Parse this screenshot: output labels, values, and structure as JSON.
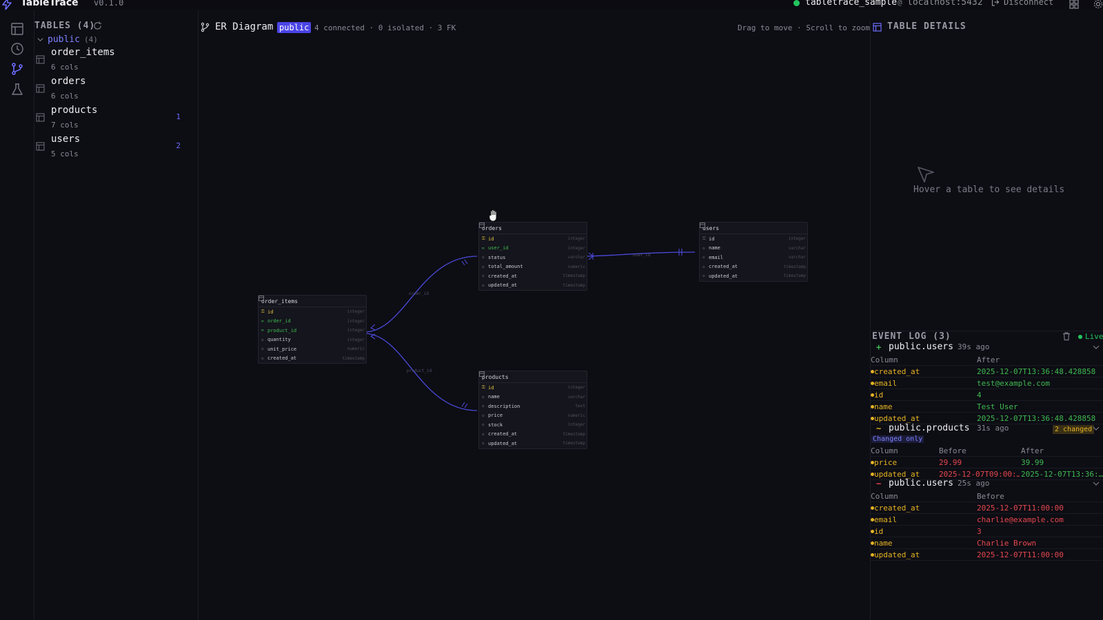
{
  "app": {
    "title": "TableTrace",
    "version": "v0.1.0"
  },
  "connection": {
    "database": "tabletrace_sample",
    "at": "@",
    "host": "localhost:5432",
    "disconnect_label": "Disconnect"
  },
  "sidebar": {
    "header": "TABLES (4)",
    "schema": {
      "name": "public",
      "count": "(4)"
    },
    "tables": [
      {
        "name": "order_items",
        "cols": "6 cols",
        "badge": ""
      },
      {
        "name": "orders",
        "cols": "6 cols",
        "badge": ""
      },
      {
        "name": "products",
        "cols": "7 cols",
        "badge": "1"
      },
      {
        "name": "users",
        "cols": "5 cols",
        "badge": "2"
      }
    ]
  },
  "er": {
    "title": "ER Diagram",
    "schema_badge": "public",
    "stats": "4 connected · 0 isolated · 3 FK",
    "hint": "Drag to move · Scroll to zoom",
    "edge_labels": [
      "user_id",
      "order_id",
      "product_id"
    ],
    "nodes": {
      "orders": {
        "title": "orders",
        "columns": [
          {
            "key": "⚿",
            "name": "id",
            "type": "integer",
            "kind": "pk"
          },
          {
            "key": "∞",
            "name": "user_id",
            "type": "integer",
            "kind": "fk"
          },
          {
            "key": "◇",
            "name": "status",
            "type": "varchar",
            "kind": ""
          },
          {
            "key": "◇",
            "name": "total_amount",
            "type": "numeric",
            "kind": ""
          },
          {
            "key": "◇",
            "name": "created_at",
            "type": "timestamp",
            "kind": ""
          },
          {
            "key": "◇",
            "name": "updated_at",
            "type": "timestamp",
            "kind": ""
          }
        ]
      },
      "users": {
        "title": "users",
        "columns": [
          {
            "key": "⚿",
            "name": "id",
            "type": "integer",
            "kind": ""
          },
          {
            "key": "◇",
            "name": "name",
            "type": "varchar",
            "kind": ""
          },
          {
            "key": "◇",
            "name": "email",
            "type": "varchar",
            "kind": ""
          },
          {
            "key": "◇",
            "name": "created_at",
            "type": "timestamp",
            "kind": ""
          },
          {
            "key": "◇",
            "name": "updated_at",
            "type": "timestamp",
            "kind": ""
          }
        ]
      },
      "order_items": {
        "title": "order_items",
        "columns": [
          {
            "key": "⚿",
            "name": "id",
            "type": "integer",
            "kind": "pk"
          },
          {
            "key": "∞",
            "name": "order_id",
            "type": "integer",
            "kind": "fk"
          },
          {
            "key": "∞",
            "name": "product_id",
            "type": "integer",
            "kind": "fk"
          },
          {
            "key": "◇",
            "name": "quantity",
            "type": "integer",
            "kind": ""
          },
          {
            "key": "◇",
            "name": "unit_price",
            "type": "numeric",
            "kind": ""
          },
          {
            "key": "◇",
            "name": "created_at",
            "type": "timestamp",
            "kind": ""
          }
        ]
      },
      "products": {
        "title": "products",
        "columns": [
          {
            "key": "⚿",
            "name": "id",
            "type": "integer",
            "kind": "pk"
          },
          {
            "key": "◇",
            "name": "name",
            "type": "varchar",
            "kind": ""
          },
          {
            "key": "◇",
            "name": "description",
            "type": "text",
            "kind": ""
          },
          {
            "key": "◇",
            "name": "price",
            "type": "numeric",
            "kind": ""
          },
          {
            "key": "◇",
            "name": "stock",
            "type": "integer",
            "kind": ""
          },
          {
            "key": "◇",
            "name": "created_at",
            "type": "timestamp",
            "kind": ""
          },
          {
            "key": "◇",
            "name": "updated_at",
            "type": "timestamp",
            "kind": ""
          }
        ]
      }
    }
  },
  "details": {
    "title": "TABLE DETAILS",
    "empty_text": "Hover a table to see details"
  },
  "event_log": {
    "title": "EVENT LOG (3)",
    "live_label": "Live",
    "events": [
      {
        "op": "+",
        "table": "public.users",
        "time": "39s ago",
        "headers": [
          "Column",
          "After"
        ],
        "rows": [
          {
            "column": "created_at",
            "after": "2025-12-07T13:36:48.428858"
          },
          {
            "column": "email",
            "after": "test@example.com"
          },
          {
            "column": "id",
            "after": "4"
          },
          {
            "column": "name",
            "after": "Test User"
          },
          {
            "column": "updated_at",
            "after": "2025-12-07T13:36:48.428858"
          }
        ]
      },
      {
        "op": "~",
        "table": "public.products",
        "time": "31s ago",
        "changed": "2 changed",
        "filter": "Changed only",
        "headers": [
          "Column",
          "Before",
          "After"
        ],
        "rows": [
          {
            "column": "price",
            "before": "29.99",
            "after": "39.99"
          },
          {
            "column": "updated_at",
            "before": "2025-12-07T09:00:…",
            "after": "2025-12-07T13:36:…"
          }
        ]
      },
      {
        "op": "−",
        "table": "public.users",
        "time": "25s ago",
        "headers": [
          "Column",
          "Before"
        ],
        "rows": [
          {
            "column": "created_at",
            "before": "2025-12-07T11:00:00"
          },
          {
            "column": "email",
            "before": "charlie@example.com"
          },
          {
            "column": "id",
            "before": "3"
          },
          {
            "column": "name",
            "before": "Charlie Brown"
          },
          {
            "column": "updated_at",
            "before": "2025-12-07T11:00:00"
          }
        ]
      }
    ]
  },
  "colors": {
    "accent": "#4b44e6",
    "edge": "#4a4ad9",
    "live": "#22c55e",
    "pk": "#e3c640",
    "fk": "#3fb950",
    "added": "#3fb950",
    "removed": "#e5484d"
  }
}
